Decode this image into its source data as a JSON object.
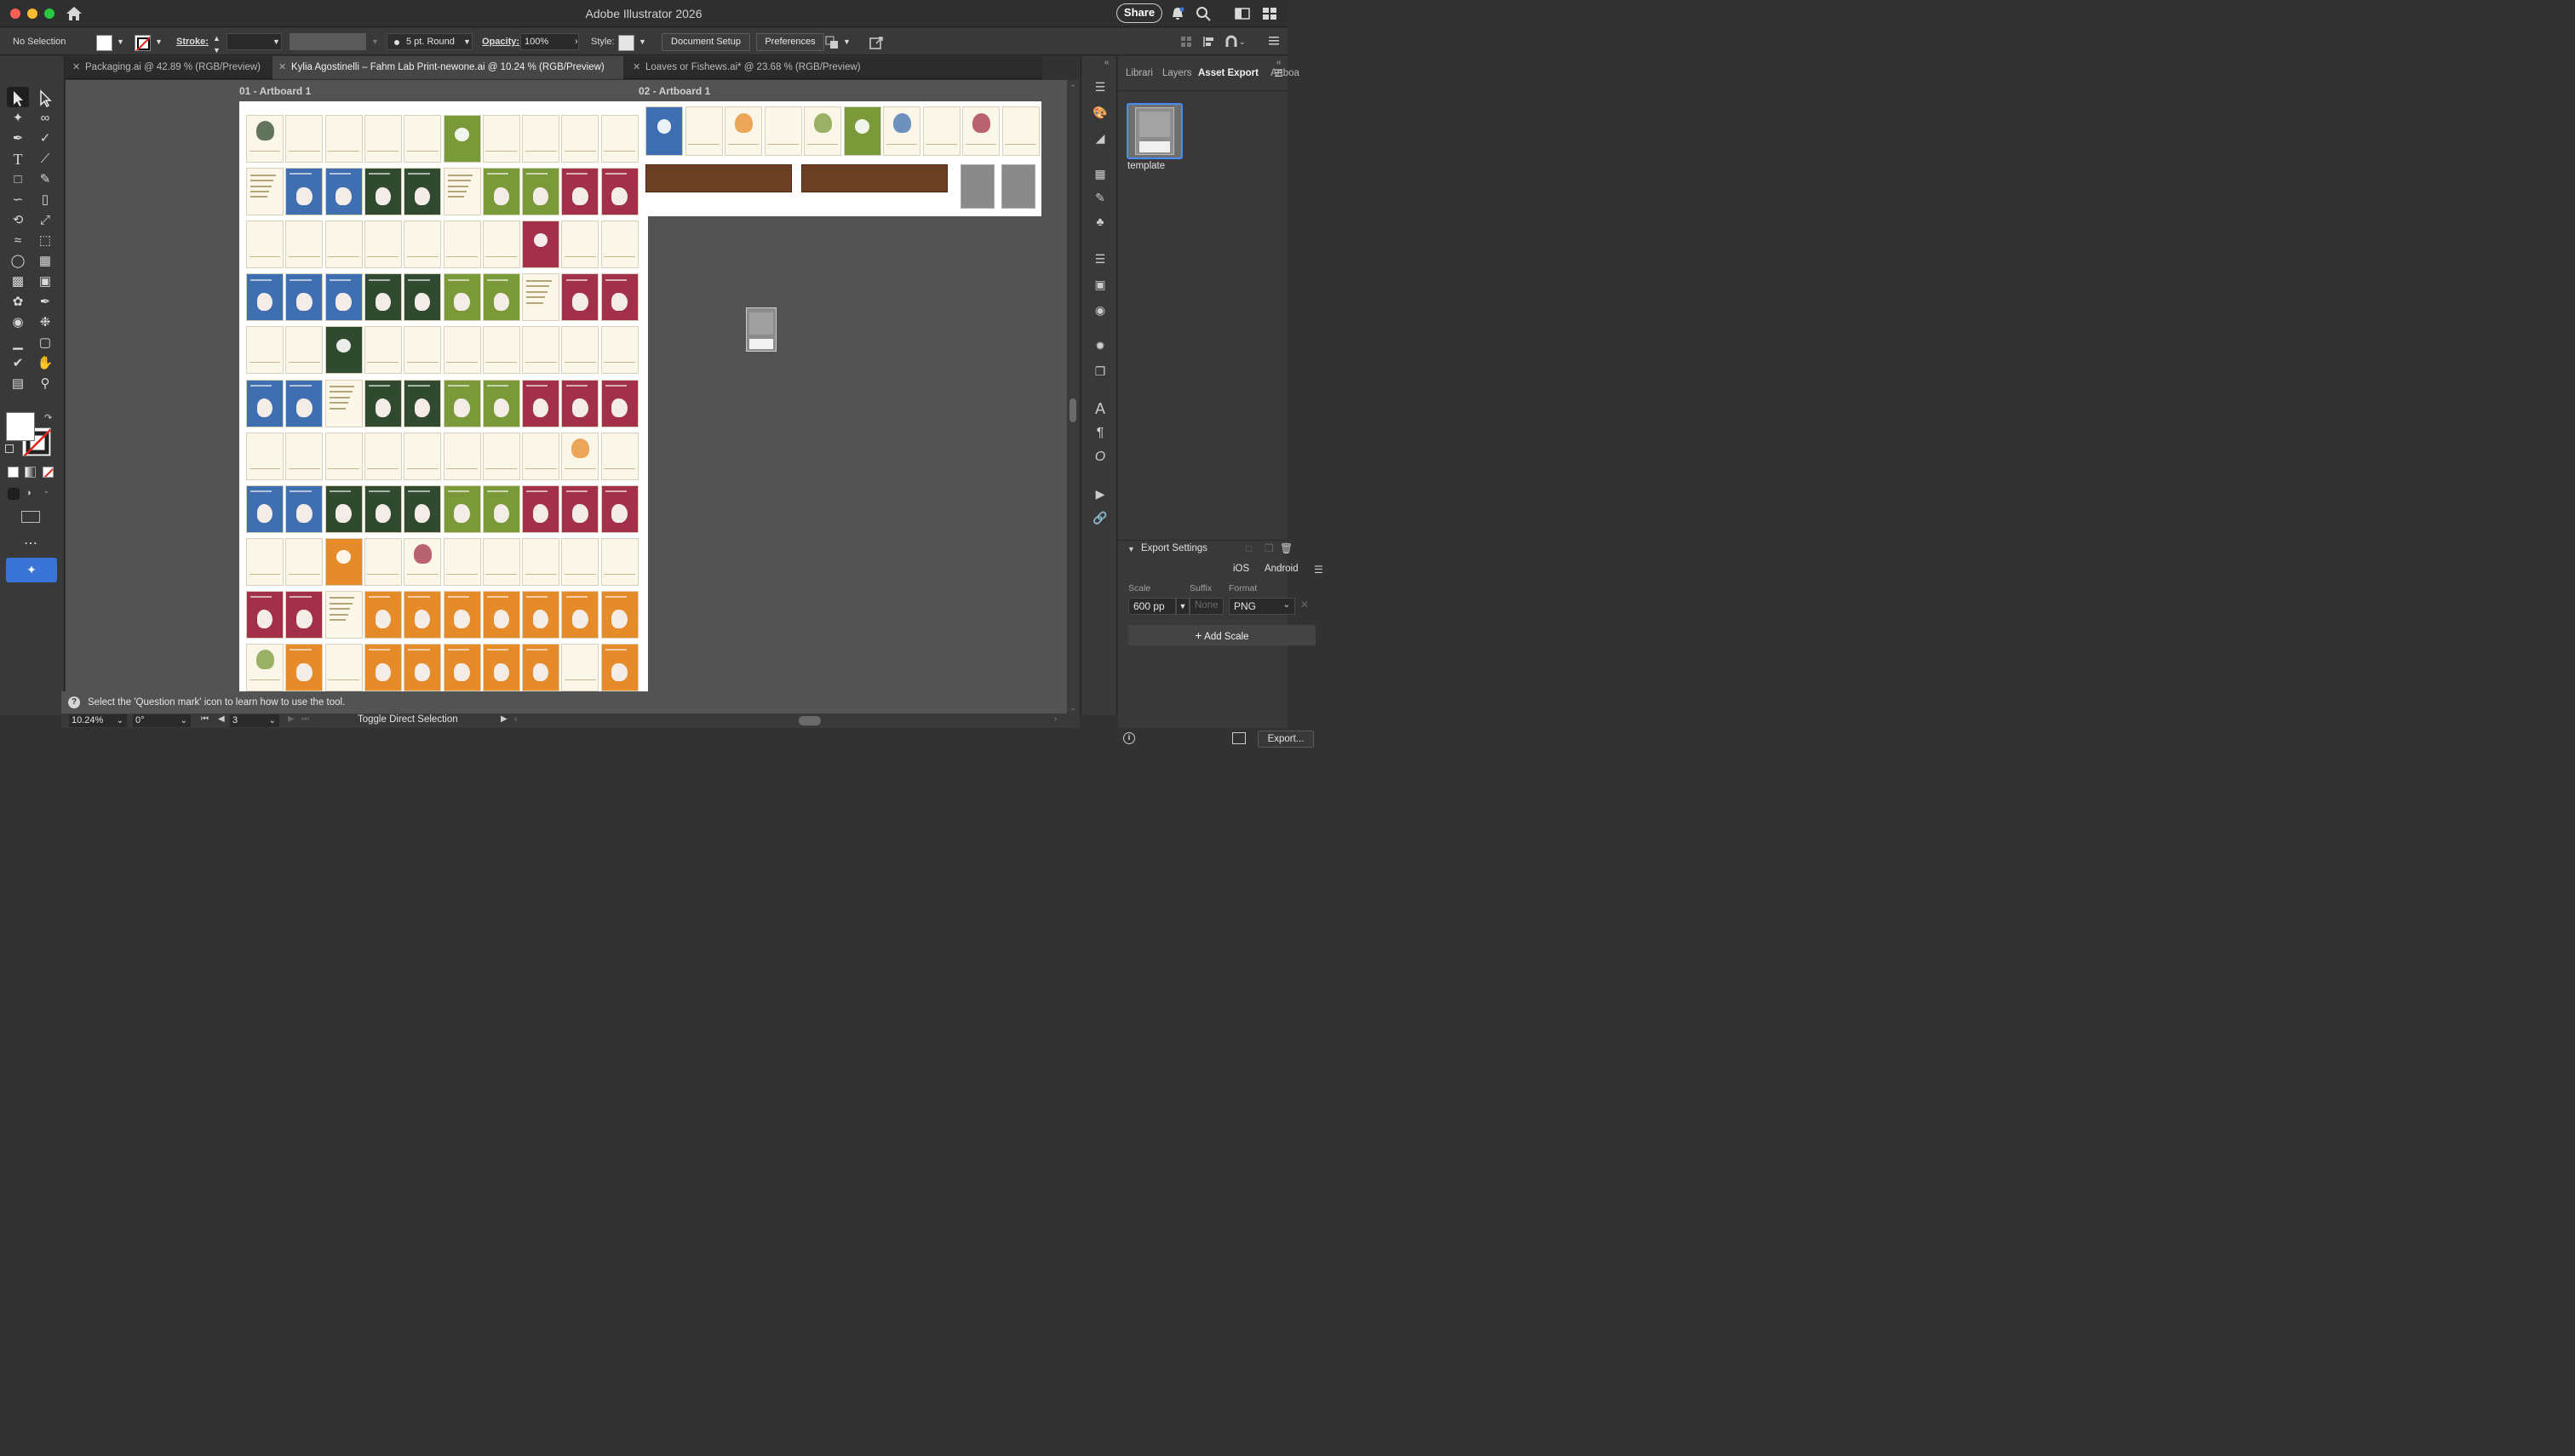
{
  "app": {
    "title": "Adobe Illustrator 2026",
    "share_label": "Share"
  },
  "control": {
    "selection": "No Selection",
    "stroke_label": "Stroke:",
    "brush": "5 pt. Round",
    "opacity_label": "Opacity:",
    "opacity_value": "100%",
    "style_label": "Style:",
    "document_setup": "Document Setup",
    "preferences": "Preferences"
  },
  "tabs": [
    {
      "label": "Packaging.ai @ 42.89 % (RGB/Preview)"
    },
    {
      "label": "Kylia Agostinelli – Fahm Lab Print-newone.ai @ 10.24 % (RGB/Preview)"
    },
    {
      "label": "Loaves or Fishews.ai* @ 23.68 % (RGB/Preview)"
    }
  ],
  "artboards": {
    "ab1": "01 - Artboard 1",
    "ab2": "02 - Artboard 1"
  },
  "panel": {
    "tabs": [
      "Librari",
      "Layers",
      "Asset Export",
      "Artboa"
    ],
    "asset_name": "template",
    "export_settings": "Export Settings",
    "ios": "iOS",
    "android": "Android",
    "scale_label": "Scale",
    "suffix_label": "Suffix",
    "format_label": "Format",
    "scale_value": "600 pp",
    "suffix_placeholder": "None",
    "format_value": "PNG",
    "add_scale": "Add Scale",
    "export_button": "Export..."
  },
  "status": {
    "hint": "Select the 'Question mark' icon to learn how to use the tool.",
    "zoom": "10.24%",
    "rotation": "0°",
    "artboard_num": "3",
    "tool_state": "Toggle Direct Selection"
  },
  "colors": {
    "blue": "#3f6fb0",
    "darkgreen": "#2f4a2e",
    "olive": "#7a9a3a",
    "maroon": "#a3304a",
    "orange": "#e68b2a",
    "cream": "#fbf7e8",
    "brown": "#6b3f22",
    "gray": "#8a8a8a",
    "accent": "#3a74d6"
  },
  "grid": [
    [
      "cream-blue-title",
      "cream",
      "cream",
      "cream",
      "cream",
      "olive-title",
      "cream",
      "cream",
      "cream",
      "cream"
    ],
    [
      "cream-text",
      "blue",
      "blue",
      "darkgreen",
      "darkgreen",
      "cream-text",
      "olive",
      "olive",
      "maroon",
      "maroon"
    ],
    [
      "cream",
      "cream",
      "cream",
      "cream",
      "cream",
      "cream",
      "cream",
      "maroon-title",
      "cream",
      "cream"
    ],
    [
      "blue",
      "blue",
      "blue",
      "darkgreen",
      "darkgreen",
      "olive",
      "olive",
      "cream-text",
      "maroon",
      "maroon"
    ],
    [
      "cream",
      "cream",
      "darkgreen-title",
      "cream",
      "cream",
      "cream",
      "cream",
      "cream",
      "cream",
      "cream"
    ],
    [
      "blue",
      "blue",
      "cream-text",
      "darkgreen",
      "darkgreen",
      "olive",
      "olive",
      "maroon",
      "maroon",
      "maroon"
    ],
    [
      "cream",
      "cream",
      "cream",
      "cream",
      "cream",
      "cream",
      "cream",
      "cream",
      "cream",
      "cream"
    ],
    [
      "blue",
      "blue",
      "darkgreen",
      "darkgreen",
      "darkgreen",
      "olive",
      "olive",
      "maroon",
      "maroon",
      "maroon"
    ],
    [
      "cream",
      "cream",
      "orange-title",
      "cream",
      "cream",
      "cream",
      "cream",
      "cream",
      "cream",
      "cream"
    ],
    [
      "maroon",
      "maroon",
      "cream-text",
      "orange",
      "orange",
      "orange",
      "orange",
      "orange",
      "orange",
      "orange"
    ],
    [
      "cream",
      "orange",
      "cream",
      "orange",
      "orange",
      "orange",
      "orange",
      "orange",
      "cream",
      "orange"
    ]
  ],
  "grid2_top": [
    "blue-title",
    "cream",
    "cream",
    "cream",
    "cream",
    "olive-title",
    "cream",
    "cream",
    "cream",
    "cream"
  ]
}
